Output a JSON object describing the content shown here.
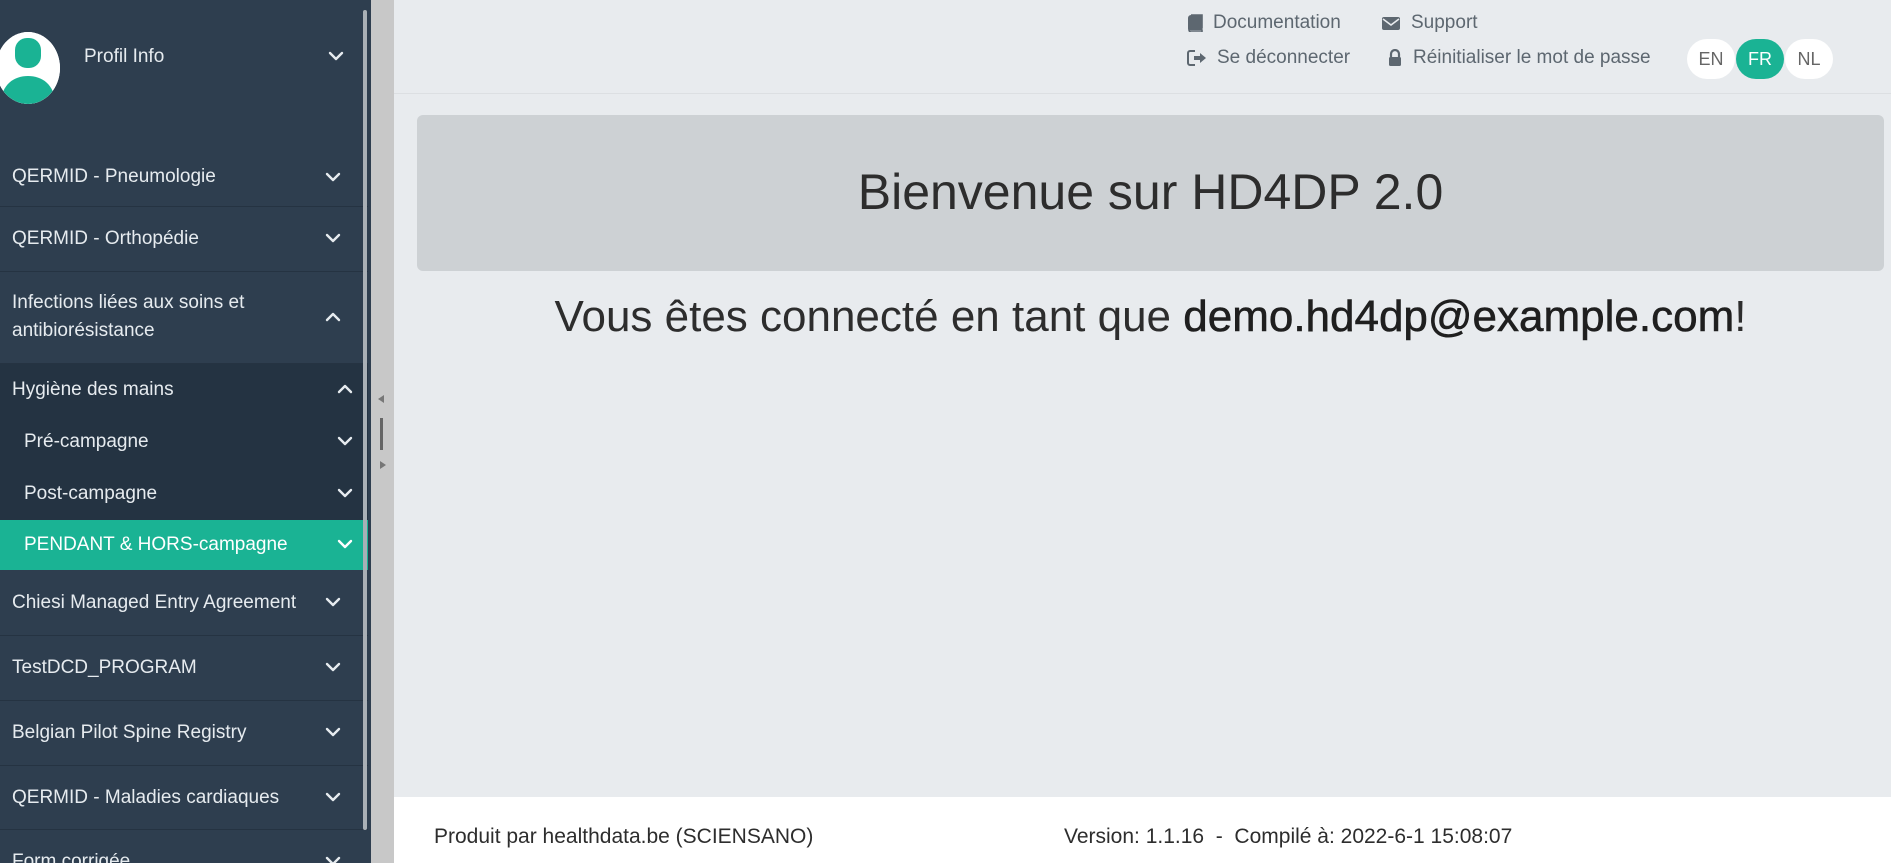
{
  "sidebar": {
    "profile_label": "Profil Info",
    "items": [
      {
        "label": "QERMID - Pneumologie"
      },
      {
        "label": "QERMID - Orthopédie"
      },
      {
        "label_line1": "Infections liées aux soins et",
        "label_line2": "antibiorésistance"
      },
      {
        "label": "Hygiène des mains"
      },
      {
        "label": "Pré-campagne"
      },
      {
        "label": "Post-campagne"
      },
      {
        "label": "PENDANT & HORS-campagne"
      },
      {
        "label": "Chiesi Managed Entry Agreement"
      },
      {
        "label": "TestDCD_PROGRAM"
      },
      {
        "label": "Belgian Pilot Spine Registry"
      },
      {
        "label": "QERMID - Maladies cardiaques"
      },
      {
        "label": "Form corrigée"
      }
    ]
  },
  "header": {
    "documentation": "Documentation",
    "support": "Support",
    "logout": "Se déconnecter",
    "reset_password": "Réinitialiser le mot de passe",
    "languages": [
      "EN",
      "FR",
      "NL"
    ],
    "active_language": "FR"
  },
  "main": {
    "welcome": "Bienvenue sur HD4DP 2.0",
    "connected_prefix": "Vous êtes connecté en tant que ",
    "user_email": "demo.hd4dp@example.com",
    "connected_suffix": "!"
  },
  "footer": {
    "produced_by": "Produit par healthdata.be (SCIENSANO)",
    "version": "Version: 1.1.16  -  Compilé à: 2022-6-1 15:08:07"
  },
  "colors": {
    "sidebar_bg": "#2e3e4f",
    "accent": "#1ab394",
    "content_bg": "#e8ebee"
  }
}
